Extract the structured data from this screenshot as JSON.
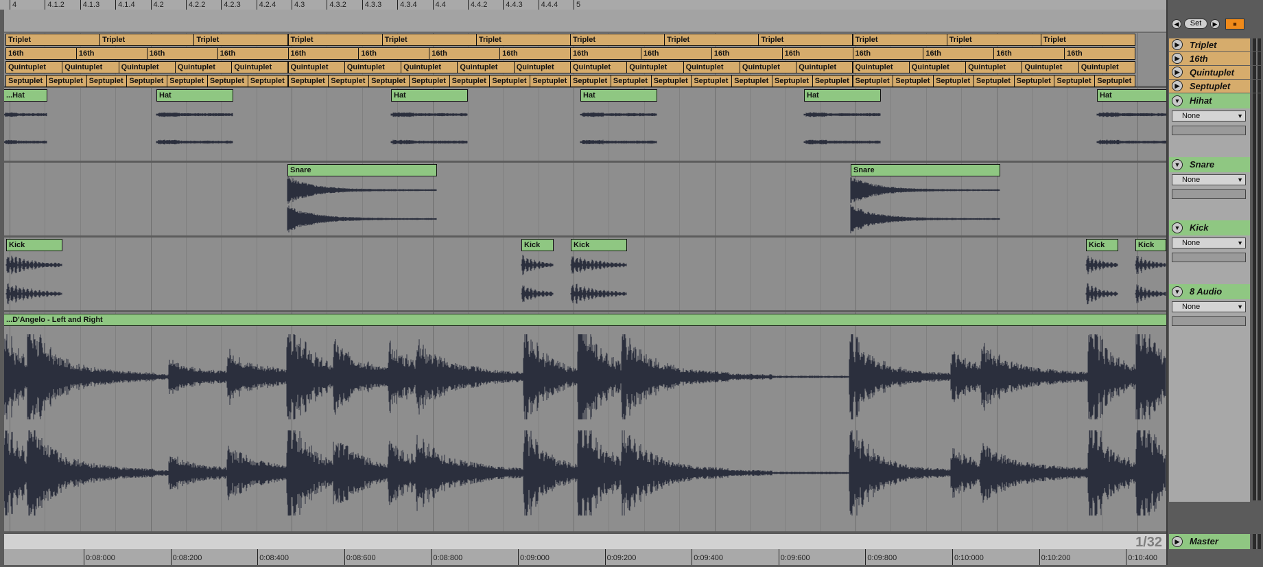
{
  "ruler": {
    "bar_labels": [
      "4",
      "4.1.2",
      "4.1.3",
      "4.1.4",
      "4.2",
      "4.2.2",
      "4.2.3",
      "4.2.4",
      "4.3",
      "4.3.2",
      "4.3.3",
      "4.3.4",
      "4.4",
      "4.4.2",
      "4.4.3",
      "4.4.4",
      "5"
    ]
  },
  "header_controls": {
    "set_label": "Set",
    "left_icon": "arrow-left-icon",
    "right_icon": "arrow-right-icon",
    "lock_icon": "lock-icon"
  },
  "tracks": [
    {
      "name": "Triplet",
      "color": "#d6ac6c",
      "clip_label": "Triplet"
    },
    {
      "name": "16th",
      "color": "#d6ac6c",
      "clip_label": "16th"
    },
    {
      "name": "Quintuplet",
      "color": "#d6ac6c",
      "clip_label": "Quintuplet"
    },
    {
      "name": "Septuplet",
      "color": "#d6ac6c",
      "clip_label": "Septuplet"
    },
    {
      "name": "Hihat",
      "color": "#8fc782",
      "clip_label": "Hat",
      "first_clip_label": "...Hat",
      "routing": "None"
    },
    {
      "name": "Snare",
      "color": "#8fc782",
      "clip_label": "Snare",
      "routing": "None"
    },
    {
      "name": "Kick",
      "color": "#8fc782",
      "clip_label": "Kick",
      "routing": "None"
    },
    {
      "name": "8 Audio",
      "color": "#8fc782",
      "clip_label": "...D'Angelo - Left and Right",
      "routing": "None"
    }
  ],
  "master": {
    "name": "Master",
    "quantization": "1/32"
  },
  "time_ruler": [
    "0:08:000",
    "0:08:200",
    "0:08:400",
    "0:08:600",
    "0:08:800",
    "0:09:000",
    "0:09:200",
    "0:09:400",
    "0:09:600",
    "0:09:800",
    "0:10:000",
    "0:10:200",
    "0:10:400"
  ],
  "colors": {
    "orange_clip": "#d6ac6c",
    "green_clip": "#8fc782",
    "waveform": "#2b2f3d",
    "lock": "#f08a1a"
  }
}
